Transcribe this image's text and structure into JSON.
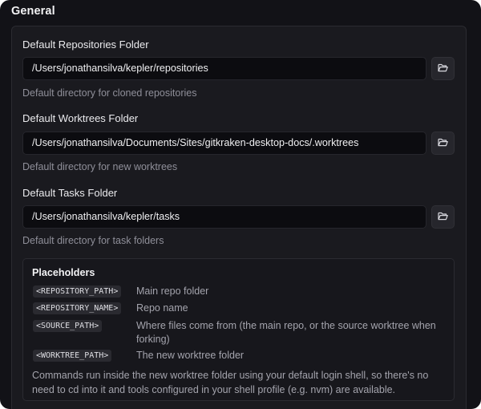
{
  "section": {
    "title": "General"
  },
  "fields": [
    {
      "label": "Default Repositories Folder",
      "value": "/Users/jonathansilva/kepler/repositories",
      "help": "Default directory for cloned repositories"
    },
    {
      "label": "Default Worktrees Folder",
      "value": "/Users/jonathansilva/Documents/Sites/gitkraken-desktop-docs/.worktrees",
      "help": "Default directory for new worktrees"
    },
    {
      "label": "Default Tasks Folder",
      "value": "/Users/jonathansilva/kepler/tasks",
      "help": "Default directory for task folders"
    }
  ],
  "placeholders": {
    "title": "Placeholders",
    "items": [
      {
        "code": "<REPOSITORY_PATH>",
        "desc": "Main repo folder"
      },
      {
        "code": "<REPOSITORY_NAME>",
        "desc": "Repo name"
      },
      {
        "code": "<SOURCE_PATH>",
        "desc": "Where files come from (the main repo, or the source worktree when forking)"
      },
      {
        "code": "<WORKTREE_PATH>",
        "desc": "The new worktree folder"
      }
    ],
    "footer": "Commands run inside the new worktree folder using your default login shell, so there's no need to cd into it and tools configured in your shell profile (e.g. nvm) are available."
  },
  "icons": {
    "browse": "folder-open-icon"
  },
  "colors": {
    "window_bg": "#121217",
    "card_bg": "#1a1a1f",
    "input_bg": "#0c0c10",
    "text_primary": "#ebebee",
    "text_secondary": "#8f8f99"
  }
}
